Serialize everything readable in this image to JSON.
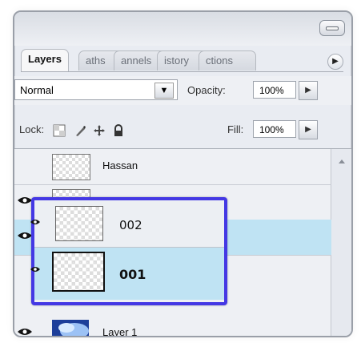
{
  "tabs": {
    "active": "Layers",
    "items": [
      "aths",
      "annels",
      "istory",
      "ctions"
    ],
    "menu_icon": "triangle-right-icon"
  },
  "blend": {
    "mode": "Normal",
    "opacity_label": "Opacity:",
    "opacity": "100%"
  },
  "lock": {
    "label": "Lock:",
    "fill_label": "Fill:",
    "fill": "100%"
  },
  "layers": [
    {
      "name": "Hassan"
    },
    {
      "name": "002"
    },
    {
      "name": "001"
    },
    {
      "name": "Layer 1"
    }
  ],
  "colors": {
    "selection": "#bfe3f3",
    "highlight_border": "#4438e4",
    "panel_bg": "#e9ecf2"
  }
}
